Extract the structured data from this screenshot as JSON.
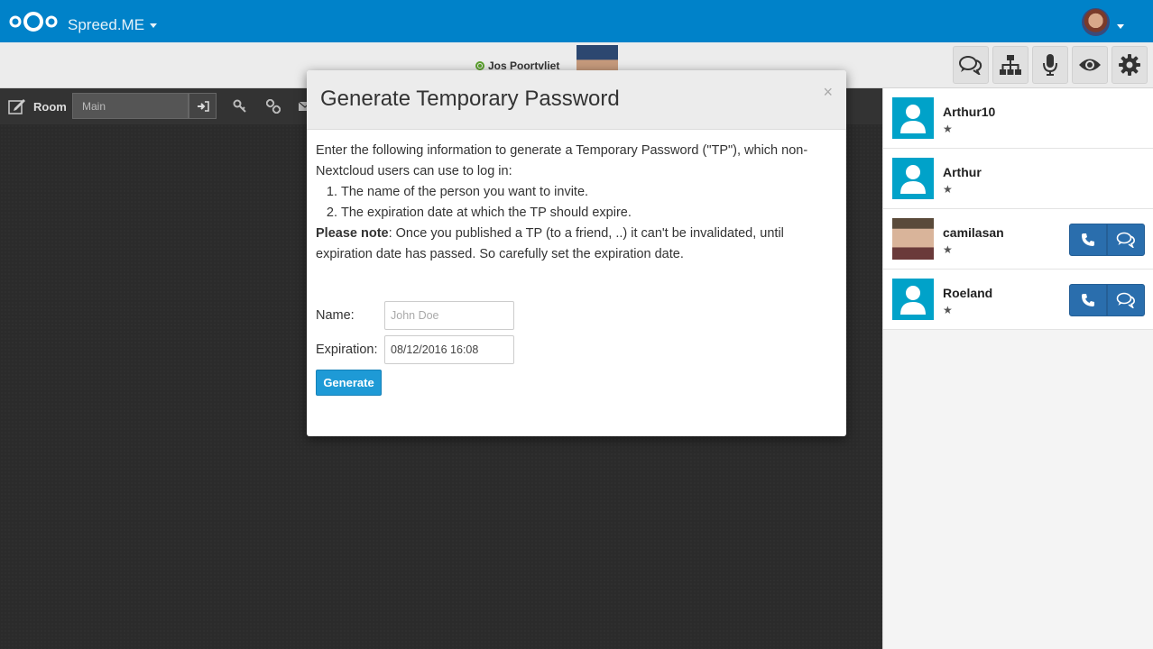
{
  "header": {
    "app_name": "Spreed.ME"
  },
  "spreedbar": {
    "self_name": "Jos Poortvliet"
  },
  "room": {
    "label": "Room",
    "input_value": "Main"
  },
  "users": [
    {
      "name": "Arthur10",
      "avatar": "default",
      "actions": false
    },
    {
      "name": "Arthur",
      "avatar": "default",
      "actions": false
    },
    {
      "name": "camilasan",
      "avatar": "photo",
      "actions": true
    },
    {
      "name": "Roeland",
      "avatar": "default",
      "actions": true
    }
  ],
  "modal": {
    "title": "Generate Temporary Password",
    "close": "×",
    "intro": "Enter the following information to generate a Temporary Password (\"TP\"), which non-Nextcloud users can use to log in:",
    "steps": [
      "The name of the person you want to invite.",
      "The expiration date at which the TP should expire."
    ],
    "note_label": "Please note",
    "note_text": ": Once you published a TP (to a friend, ..) it can't be invalidated, until expiration date has passed. So carefully set the expiration date.",
    "name_label": "Name:",
    "name_placeholder": "John Doe",
    "expiration_label": "Expiration:",
    "expiration_value": "08/12/2016 16:08",
    "generate_label": "Generate"
  },
  "colors": {
    "header_blue": "#0082c9",
    "avatar_teal": "#00a2c9",
    "action_blue": "#2a6ead",
    "generate_blue": "#1e9ad6"
  }
}
